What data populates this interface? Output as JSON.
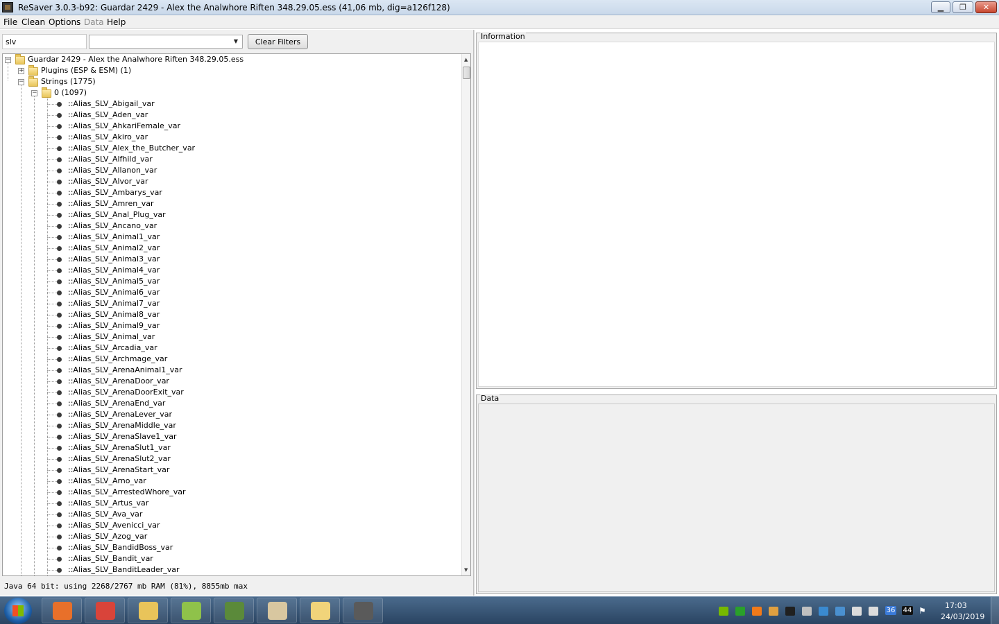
{
  "window": {
    "title": "ReSaver 3.0.3-b92: Guardar 2429 - Alex the Analwhore  Riften  348.29.05.ess (41,06 mb, dig=a126f128)",
    "minimize_icon": "minimize-icon",
    "maximize_icon": "restore-icon",
    "close_icon": "close-icon",
    "minimize_glyph": "▁",
    "maximize_glyph": "❐",
    "close_glyph": "✕"
  },
  "menu": [
    "File",
    "Clean",
    "Options",
    "Data",
    "Help"
  ],
  "menu_disabled": [
    "Data"
  ],
  "filter": {
    "text_value": "slv",
    "combo_value": "",
    "clear_label": "Clear Filters"
  },
  "tree": {
    "root": "Guardar 2429 - Alex the Analwhore  Riften  348.29.05.ess",
    "plugins": "Plugins (ESP & ESM) (1)",
    "strings": "Strings (1775)",
    "group": "0 (1097)",
    "items": [
      "::Alias_SLV_Abigail_var",
      "::Alias_SLV_Aden_var",
      "::Alias_SLV_AhkariFemale_var",
      "::Alias_SLV_Akiro_var",
      "::Alias_SLV_Alex_the_Butcher_var",
      "::Alias_SLV_Alfhild_var",
      "::Alias_SLV_Allanon_var",
      "::Alias_SLV_Alvor_var",
      "::Alias_SLV_Ambarys_var",
      "::Alias_SLV_Amren_var",
      "::Alias_SLV_Anal_Plug_var",
      "::Alias_SLV_Ancano_var",
      "::Alias_SLV_Animal1_var",
      "::Alias_SLV_Animal2_var",
      "::Alias_SLV_Animal3_var",
      "::Alias_SLV_Animal4_var",
      "::Alias_SLV_Animal5_var",
      "::Alias_SLV_Animal6_var",
      "::Alias_SLV_Animal7_var",
      "::Alias_SLV_Animal8_var",
      "::Alias_SLV_Animal9_var",
      "::Alias_SLV_Animal_var",
      "::Alias_SLV_Arcadia_var",
      "::Alias_SLV_Archmage_var",
      "::Alias_SLV_ArenaAnimal1_var",
      "::Alias_SLV_ArenaDoor_var",
      "::Alias_SLV_ArenaDoorExit_var",
      "::Alias_SLV_ArenaEnd_var",
      "::Alias_SLV_ArenaLever_var",
      "::Alias_SLV_ArenaMiddle_var",
      "::Alias_SLV_ArenaSlave1_var",
      "::Alias_SLV_ArenaSlut1_var",
      "::Alias_SLV_ArenaSlut2_var",
      "::Alias_SLV_ArenaStart_var",
      "::Alias_SLV_Arno_var",
      "::Alias_SLV_ArrestedWhore_var",
      "::Alias_SLV_Artus_var",
      "::Alias_SLV_Ava_var",
      "::Alias_SLV_Avenicci_var",
      "::Alias_SLV_Azog_var",
      "::Alias_SLV_BandidBoss_var",
      "::Alias_SLV_Bandit_var",
      "::Alias_SLV_BanditLeader_var"
    ]
  },
  "status": "Java 64 bit: using 2268/2767 mb RAM (81%), 8855mb max",
  "panels": {
    "information": "Information",
    "data": "Data"
  },
  "taskbar": {
    "apps": [
      {
        "icon": "firefox-icon",
        "color": "#e8702a"
      },
      {
        "icon": "chrome-icon",
        "color": "#d9443a"
      },
      {
        "icon": "explorer-icon",
        "color": "#e9c45a"
      },
      {
        "icon": "notepad-plus-icon",
        "color": "#8fc24a"
      },
      {
        "icon": "minecraft-icon",
        "color": "#5b8a3a"
      },
      {
        "icon": "tornado-icon",
        "color": "#d8c7a0"
      },
      {
        "icon": "folder-icon",
        "color": "#f1d47a"
      },
      {
        "icon": "resaver-icon",
        "color": "#5a5a5a"
      }
    ],
    "tray_icons": [
      {
        "icon": "nvidia-icon",
        "color": "#76b900"
      },
      {
        "icon": "battery-icon",
        "color": "#2aa02a"
      },
      {
        "icon": "avast-icon",
        "color": "#f07a1a"
      },
      {
        "icon": "hamachi-icon",
        "color": "#e0a040"
      },
      {
        "icon": "monitor-icon",
        "color": "#202020"
      },
      {
        "icon": "pointer-icon",
        "color": "#c0c0c0"
      },
      {
        "icon": "update-icon",
        "color": "#3a8ad0"
      },
      {
        "icon": "network-adapter-icon",
        "color": "#4a90d0"
      },
      {
        "icon": "volume-icon",
        "color": "#dcdcdc"
      },
      {
        "icon": "signal-icon",
        "color": "#dcdcdc"
      }
    ],
    "tray_badges": [
      {
        "icon": "temperature-icon",
        "text": "36",
        "color": "#3a7ad8"
      },
      {
        "icon": "temperature-icon",
        "text": "44",
        "color": "#111111"
      }
    ],
    "flag_icon": "action-center-flag-icon",
    "time": "17:03",
    "date": "24/03/2019"
  }
}
